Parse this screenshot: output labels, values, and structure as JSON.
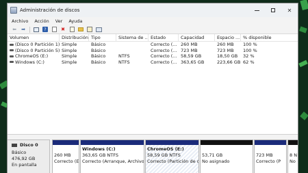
{
  "window": {
    "title": "Administración de discos"
  },
  "window_buttons": {
    "minimize": "",
    "maximize": "",
    "close": "✕"
  },
  "menu": [
    "Archivo",
    "Acción",
    "Ver",
    "Ayuda"
  ],
  "toolbar_icons": [
    "back-arrow-icon",
    "forward-arrow-icon",
    "grid-icon",
    "help-icon",
    "doc-icon",
    "delete-icon",
    "check-icon",
    "folder-icon",
    "properties-icon",
    "list-view-icon"
  ],
  "volumes": {
    "columns": [
      "Volumen",
      "Distribución",
      "Tipo",
      "Sistema de ...",
      "Estado",
      "Capacidad",
      "Espacio ...",
      "% disponible"
    ],
    "rows": [
      [
        "(Disco 0 Partición 1)",
        "Simple",
        "Básico",
        "",
        "Correcto (...",
        "260 MB",
        "260 MB",
        "100 %"
      ],
      [
        "(Disco 0 Partición 5)",
        "Simple",
        "Básico",
        "",
        "Correcto (...",
        "723 MB",
        "723 MB",
        "100 %"
      ],
      [
        "ChromeOS (E:)",
        "Simple",
        "Básico",
        "NTFS",
        "Correcto (...",
        "58,59 GB",
        "18,50 GB",
        "32 %"
      ],
      [
        "Windows (C:)",
        "Simple",
        "Básico",
        "NTFS",
        "Correcto (...",
        "363,65 GB",
        "223,66 GB",
        "62 %"
      ]
    ]
  },
  "disk": {
    "name": "Disco 0",
    "type": "Básico",
    "size": "476,92 GB",
    "status": "En pantalla"
  },
  "partitions": [
    {
      "name": "",
      "size": "260 MB",
      "status": "Correcto (E"
    },
    {
      "name": "Windows  (C:)",
      "size": "363,65 GB NTFS",
      "status": "Correcto (Arranque, Archivo"
    },
    {
      "name": "ChromeOS  (E:)",
      "size": "58,59 GB NTFS",
      "status": "Correcto (Partición de d"
    },
    {
      "name": "",
      "size": "53,71 GB",
      "status": "No asignado"
    },
    {
      "name": "",
      "size": "723 MB",
      "status": "Correcto (P"
    },
    {
      "name": "",
      "size": "8 N",
      "status": "No"
    }
  ],
  "colors": {
    "primary_partition_bar": "#1b2b7a",
    "unallocated_bar": "#111111",
    "background": "#0f2c1a"
  }
}
